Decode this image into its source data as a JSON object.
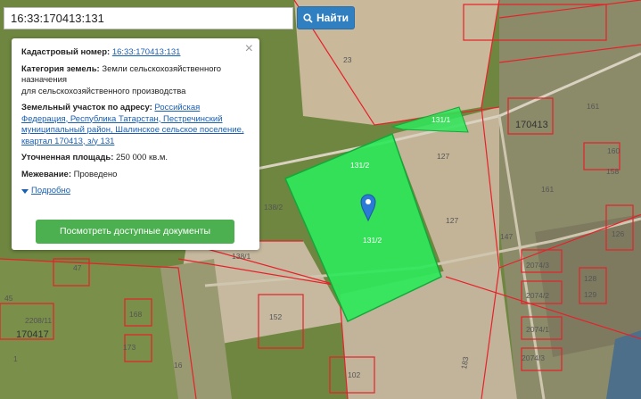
{
  "search": {
    "value": "16:33:170413:131",
    "button_label": "Найти"
  },
  "popup": {
    "cadastral_label": "Кадастровый номер:",
    "cadastral_value": "16:33:170413:131",
    "category_label": "Категория земель:",
    "category_line1": "Земли сельскохозяйственного",
    "category_line2": "назначения",
    "category_line3": "для сельскохозяйственного производства",
    "address_label": "Земельный участок по адресу:",
    "address_line1": "Российская",
    "address_line2": "Федерация, Республика Татарстан, Пестречинский",
    "address_line3": "муниципальный район, Шалинское сельское поселение,",
    "address_line4": "квартал 170413, з/у 131",
    "area_label": "Уточненная площадь:",
    "area_value": "250 000 кв.м.",
    "survey_label": "Межевание:",
    "survey_value": "Проведено",
    "details_label": "Подробно",
    "docs_button": "Посмотреть доступные документы"
  },
  "map": {
    "parcel_labels": [
      "23",
      "131/1",
      "131/2",
      "131/2",
      "127",
      "127",
      "161",
      "160",
      "158",
      "147",
      "126",
      "2074/3",
      "2074/2",
      "2074/1",
      "2074/3",
      "128",
      "129",
      "138/2",
      "138/1",
      "152",
      "168",
      "173",
      "16",
      "47",
      "45",
      "2208/11",
      "102",
      "183",
      "161",
      "1"
    ],
    "quarter_labels": [
      "170413",
      "170417"
    ],
    "colors": {
      "selected_parcel": "#2ee85a",
      "boundary": "#e8202a",
      "marker": "#2a7ad6"
    }
  }
}
